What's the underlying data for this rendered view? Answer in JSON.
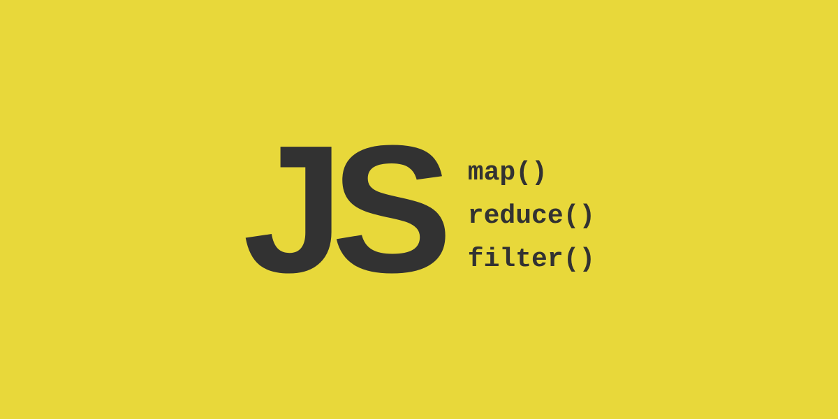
{
  "logo": "JS",
  "methods": {
    "item0": "map()",
    "item1": "reduce()",
    "item2": "filter()"
  },
  "colors": {
    "background": "#e8d83a",
    "text": "#323232"
  }
}
